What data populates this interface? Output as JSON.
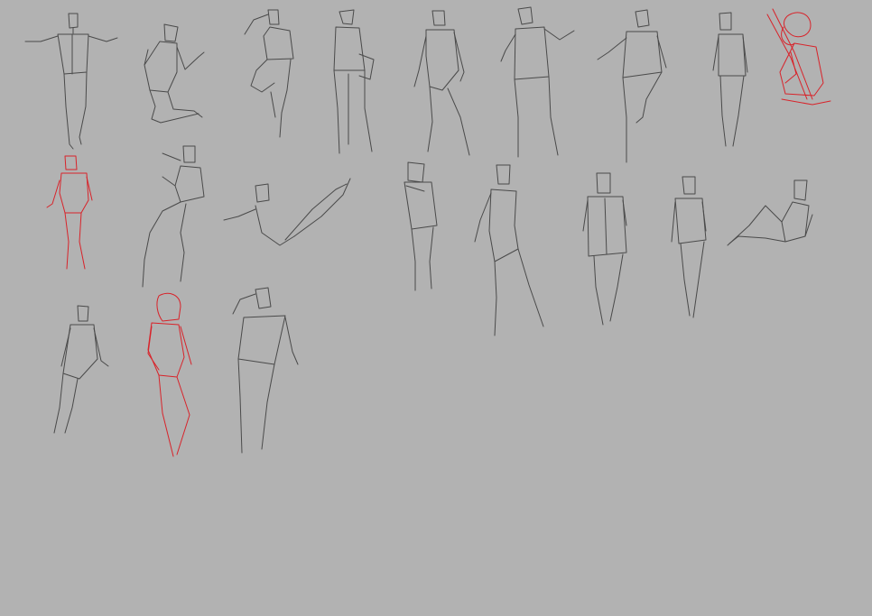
{
  "canvas": {
    "background": "#b2b2b2",
    "stroke_gray": "#4a4a4a",
    "stroke_red": "#d8232a"
  },
  "figures": [
    {
      "id": "fig-01",
      "row": 1,
      "pose": "standing-arms-out",
      "ink": "gray"
    },
    {
      "id": "fig-02",
      "row": 1,
      "pose": "kneeling",
      "ink": "gray"
    },
    {
      "id": "fig-03",
      "row": 1,
      "pose": "hand-on-head-leg-raised",
      "ink": "gray"
    },
    {
      "id": "fig-04",
      "row": 1,
      "pose": "standing-holding-object",
      "ink": "gray"
    },
    {
      "id": "fig-05",
      "row": 1,
      "pose": "standing-hip-shift",
      "ink": "gray"
    },
    {
      "id": "fig-06",
      "row": 1,
      "pose": "standing-arm-raised",
      "ink": "gray"
    },
    {
      "id": "fig-07",
      "row": 1,
      "pose": "standing-leg-bent",
      "ink": "gray"
    },
    {
      "id": "fig-08",
      "row": 1,
      "pose": "standing-back-view",
      "ink": "gray"
    },
    {
      "id": "fig-09",
      "row": 1,
      "pose": "seated-with-staff",
      "ink": "red"
    },
    {
      "id": "fig-10",
      "row": 2,
      "pose": "standing-contrapposto",
      "ink": "red"
    },
    {
      "id": "fig-11",
      "row": 2,
      "pose": "crouching-twist",
      "ink": "gray"
    },
    {
      "id": "fig-12",
      "row": 2,
      "pose": "reclining-leg-up",
      "ink": "gray"
    },
    {
      "id": "fig-13",
      "row": 2,
      "pose": "standing-arms-crossed-up",
      "ink": "gray"
    },
    {
      "id": "fig-14",
      "row": 2,
      "pose": "standing-back-arched",
      "ink": "gray"
    },
    {
      "id": "fig-15",
      "row": 2,
      "pose": "standing-back-view",
      "ink": "gray"
    },
    {
      "id": "fig-16",
      "row": 2,
      "pose": "standing-front",
      "ink": "gray"
    },
    {
      "id": "fig-17",
      "row": 2,
      "pose": "seated-leaning-back",
      "ink": "gray"
    },
    {
      "id": "fig-18",
      "row": 3,
      "pose": "standing-side",
      "ink": "gray"
    },
    {
      "id": "fig-19",
      "row": 3,
      "pose": "walking-back-view",
      "ink": "red"
    },
    {
      "id": "fig-20",
      "row": 3,
      "pose": "hand-on-head-standing",
      "ink": "gray"
    }
  ]
}
